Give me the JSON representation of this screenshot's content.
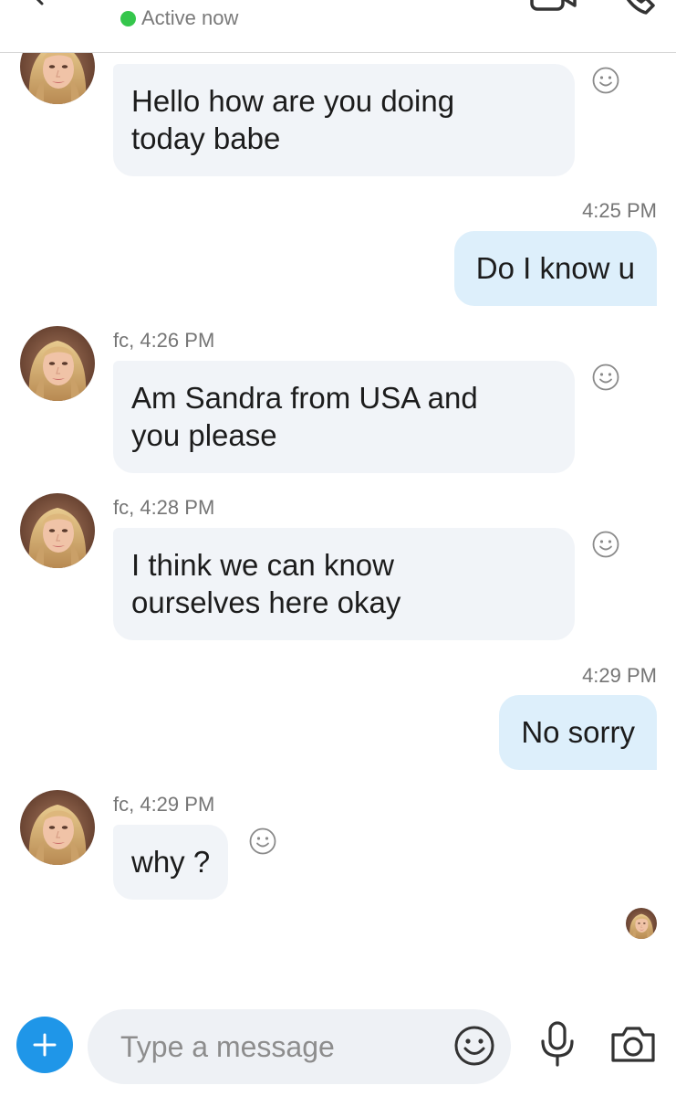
{
  "header": {
    "status": "Active now",
    "status_color": "#35c64c"
  },
  "icons": {
    "back": "chevron-left-icon",
    "video": "video-call-icon",
    "call": "phone-icon",
    "react": "smiley-icon",
    "add": "plus-icon",
    "emoji": "emoji-icon",
    "mic": "microphone-icon",
    "camera": "camera-icon"
  },
  "messages": [
    {
      "direction": "incoming",
      "text_lines": [
        "Hello how are you doing",
        "today babe"
      ]
    },
    {
      "direction": "outgoing",
      "time": "4:25 PM",
      "text": "Do I know u"
    },
    {
      "direction": "incoming",
      "meta": "fc, 4:26 PM",
      "text_lines": [
        "Am Sandra from USA and",
        "you please"
      ]
    },
    {
      "direction": "incoming",
      "meta": "fc, 4:28 PM",
      "text_lines": [
        "I think we can know",
        "ourselves here okay"
      ]
    },
    {
      "direction": "outgoing",
      "time": "4:29 PM",
      "text": "No sorry"
    },
    {
      "direction": "incoming",
      "meta": "fc, 4:29 PM",
      "text": "why ?"
    }
  ],
  "composer": {
    "placeholder": "Type a message",
    "accent_color": "#1f96e8"
  },
  "colors": {
    "incoming_bubble": "#f1f4f8",
    "outgoing_bubble": "#ddeffb"
  }
}
